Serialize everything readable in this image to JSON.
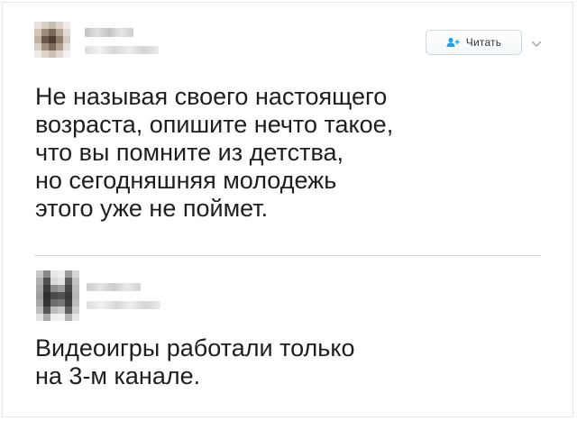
{
  "tweet": {
    "author_name": "",
    "author_handle": "",
    "follow_label": "Читать",
    "text": "Не называя своего настоящего\nвозраста, опишите нечто такое,\nчто вы помните из детства,\nно сегодняшняя молодежь\nэтого уже не поймет."
  },
  "reply": {
    "author_name": "",
    "author_handle": "",
    "text": "Видеоигры работали только\nна 3-м канале."
  },
  "icons": {
    "follow": "add-user-icon",
    "menu": "chevron-down-icon"
  },
  "colors": {
    "accent": "#1da1f2",
    "text": "#1e1e1e",
    "divider": "#d3d3d3"
  }
}
